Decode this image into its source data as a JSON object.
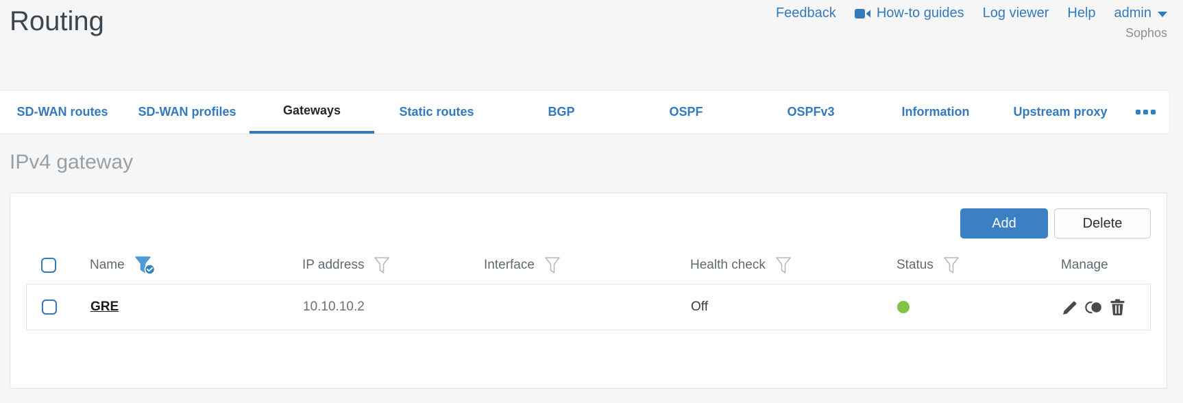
{
  "header": {
    "title": "Routing",
    "brand": "Sophos",
    "links": {
      "feedback": "Feedback",
      "howto_guides": "How-to guides",
      "log_viewer": "Log viewer",
      "help": "Help",
      "user": "admin"
    }
  },
  "tabs": [
    {
      "label": "SD-WAN routes",
      "active": false
    },
    {
      "label": "SD-WAN profiles",
      "active": false
    },
    {
      "label": "Gateways",
      "active": true
    },
    {
      "label": "Static routes",
      "active": false
    },
    {
      "label": "BGP",
      "active": false
    },
    {
      "label": "OSPF",
      "active": false
    },
    {
      "label": "OSPFv3",
      "active": false
    },
    {
      "label": "Information",
      "active": false
    },
    {
      "label": "Upstream proxy",
      "active": false
    }
  ],
  "section": {
    "heading": "IPv4 gateway"
  },
  "toolbar": {
    "add": "Add",
    "delete": "Delete"
  },
  "table": {
    "headers": {
      "name": "Name",
      "ip": "IP address",
      "interface": "Interface",
      "health": "Health check",
      "status": "Status",
      "manage": "Manage"
    },
    "filters": {
      "name": "active",
      "ip": "inactive",
      "interface": "inactive",
      "health": "inactive",
      "status": "inactive"
    },
    "rows": [
      {
        "name": "GRE",
        "ip": "10.10.10.2",
        "interface": "",
        "health_check": "Off",
        "status": "up"
      }
    ]
  },
  "colors": {
    "accent_blue": "#3279be",
    "button_blue": "#3a80c2",
    "status_green": "#82c341",
    "active_tab_text": "#22272c"
  }
}
